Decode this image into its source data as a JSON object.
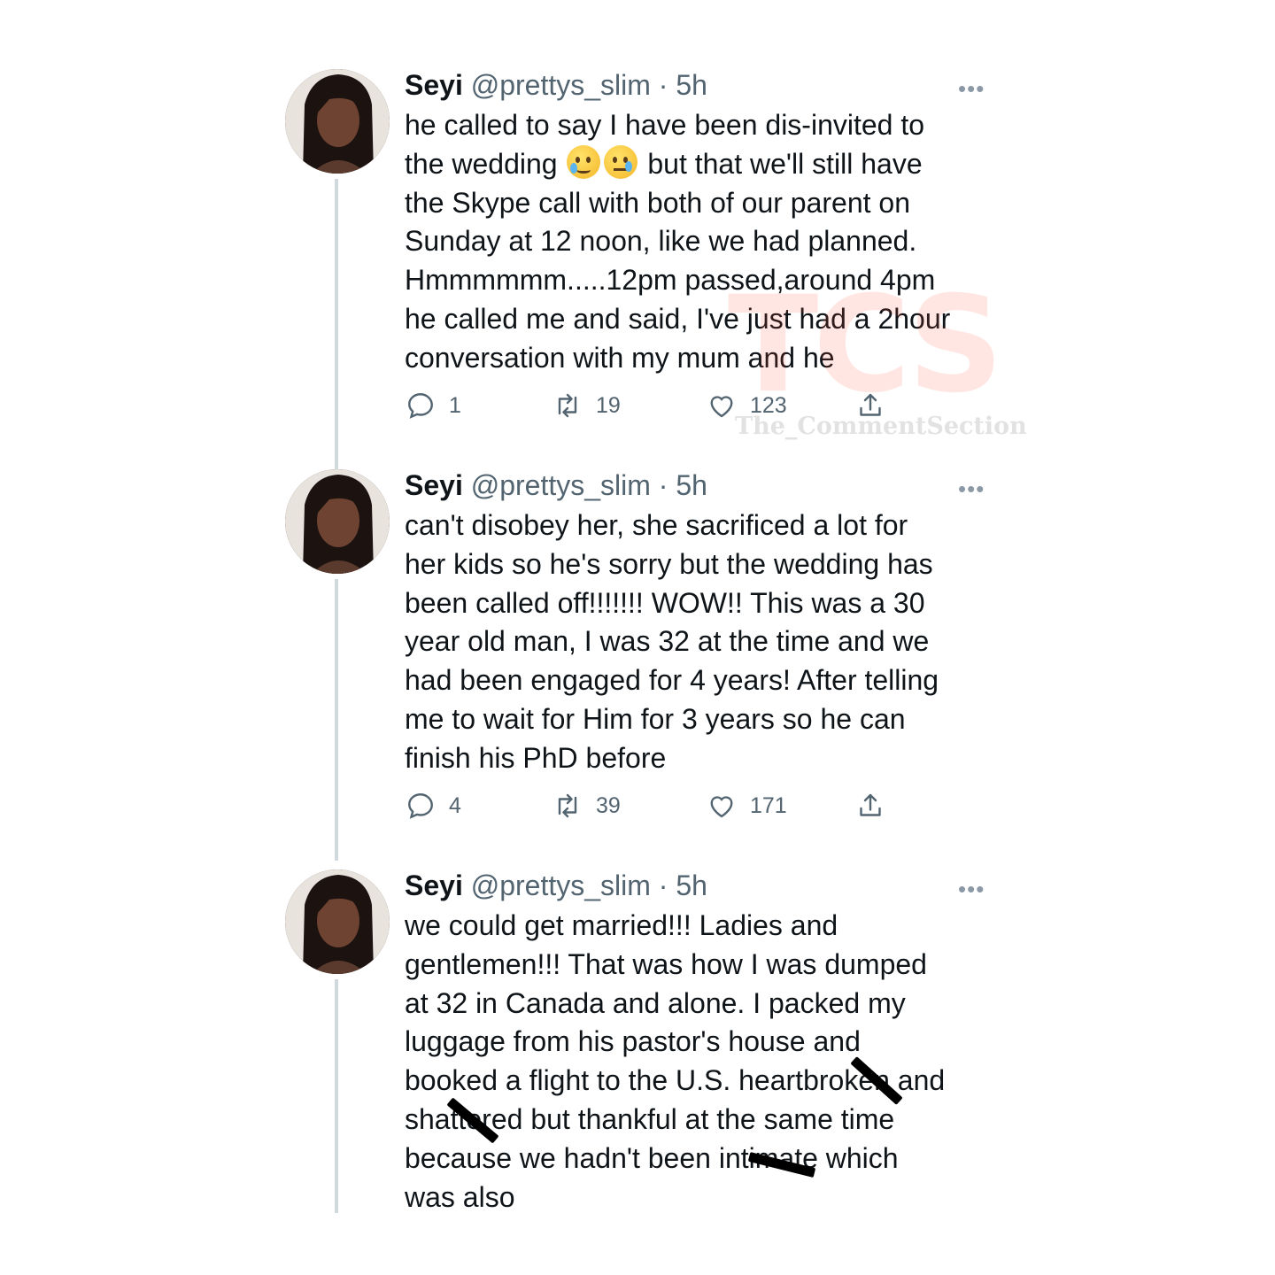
{
  "tweets": [
    {
      "name": "Seyi",
      "handle": "@prettys_slim",
      "time": "5h",
      "text_before_emoji": "he called to say I have been dis-invited to\nthe wedding ",
      "emojis": [
        "face-holding-back-tears-emoji",
        "crying-face-emoji"
      ],
      "text_after_emoji": " but that we'll still have\nthe Skype call with both of our parent on\nSunday at 12 noon, like we had planned.\nHmmmmmm.....12pm passed,around 4pm\nhe called me and said, I've just had a 2hour\nconversation with my mum and he",
      "replies": "1",
      "retweets": "19",
      "likes": "123"
    },
    {
      "name": "Seyi",
      "handle": "@prettys_slim",
      "time": "5h",
      "text": "can't disobey her, she sacrificed a lot for\nher kids so he's sorry but the wedding has\nbeen called off!!!!!!! WOW!! This was a 30\nyear old man, I was 32 at the time and we\nhad been engaged for 4 years! After telling\nme to wait for Him for 3 years so he can\nfinish his PhD before",
      "replies": "4",
      "retweets": "39",
      "likes": "171"
    },
    {
      "name": "Seyi",
      "handle": "@prettys_slim",
      "time": "5h",
      "text": "we could get married!!! Ladies and\ngentlemen!!! That was how I was dumped\nat 32 in Canada and alone. I packed my\nluggage from his pastor's house and\nbooked a flight to the U.S. heartbroken and\nshattered but thankful at the same time\nbecause we hadn't been intimate which\nwas also"
    }
  ],
  "separator": "·",
  "more_label": "•••",
  "watermark": {
    "logo_text": "TCS",
    "caption": "The_CommentSection"
  },
  "colors": {
    "text": "#0f1419",
    "secondary": "#536471",
    "thread_line": "#cfd9de",
    "watermark_red": "#ff5032"
  }
}
